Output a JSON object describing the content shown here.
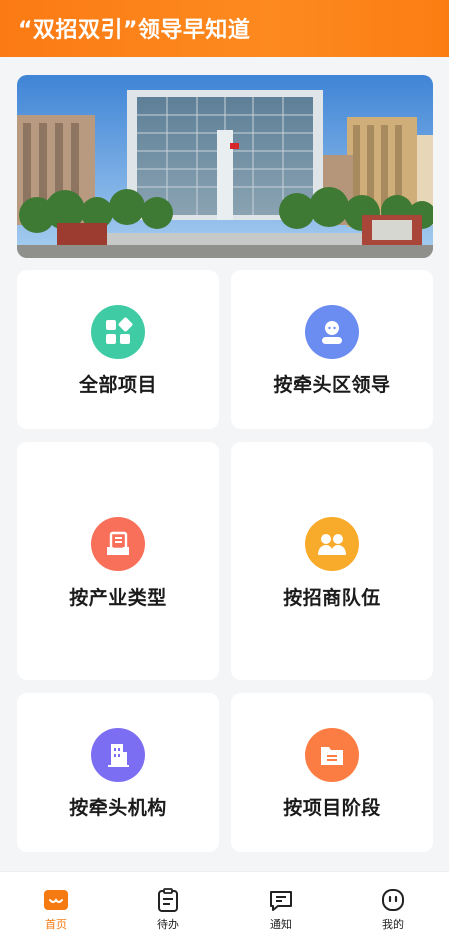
{
  "header": {
    "title": "“双招双引”领导早知道"
  },
  "banner": {
    "image": "government-building-photo"
  },
  "cards": [
    {
      "label": "全部项目",
      "icon": "grid-apps-icon",
      "color": "#3fcca4"
    },
    {
      "label": "按牵头区领导",
      "icon": "user-avatar-icon",
      "color": "#6b8cf0"
    },
    {
      "label": "按产业类型",
      "icon": "document-tray-icon",
      "color": "#f8705a"
    },
    {
      "label": "按招商队伍",
      "icon": "team-people-icon",
      "color": "#f8aa2a"
    },
    {
      "label": "按牵头机构",
      "icon": "building-icon",
      "color": "#7c6ef2"
    },
    {
      "label": "按项目阶段",
      "icon": "folder-icon",
      "color": "#fb7d43"
    }
  ],
  "tabbar": {
    "active_color": "#f57a12",
    "items": [
      {
        "label": "首页",
        "icon": "home-icon",
        "active": true
      },
      {
        "label": "待办",
        "icon": "clipboard-icon",
        "active": false
      },
      {
        "label": "通知",
        "icon": "message-icon",
        "active": false
      },
      {
        "label": "我的",
        "icon": "profile-face-icon",
        "active": false
      }
    ]
  }
}
